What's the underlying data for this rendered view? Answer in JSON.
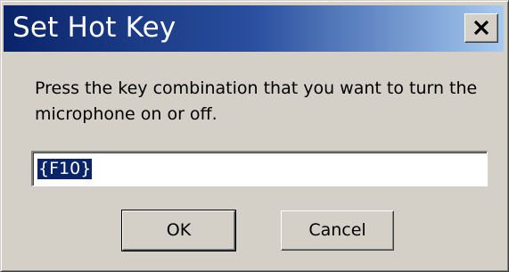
{
  "window": {
    "title": "Set Hot Key",
    "close_icon": "close-icon"
  },
  "dialog": {
    "message": "Press the key combination that you want to turn the microphone on or off.",
    "hotkey_value": "{F10}"
  },
  "buttons": {
    "ok_label": "OK",
    "cancel_label": "Cancel"
  },
  "colors": {
    "titlebar_start": "#0a246a",
    "titlebar_end": "#a6caf0",
    "dialog_face": "#d4d0c8",
    "selection": "#0a246a"
  }
}
